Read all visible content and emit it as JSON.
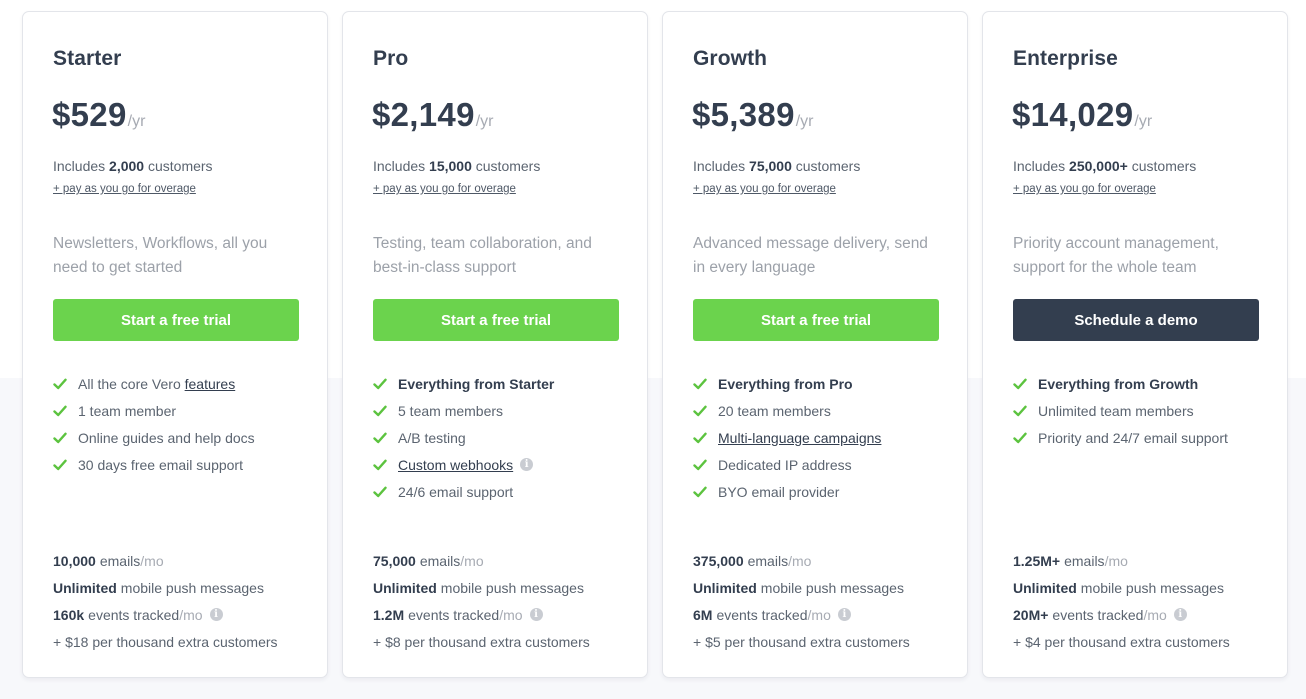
{
  "colors": {
    "accent_green": "#6bd34d",
    "dark_button": "#333e4f",
    "check_green": "#5cc33f"
  },
  "plans": [
    {
      "name": "Starter",
      "price": "$529",
      "period": "/yr",
      "includes_prefix": "Includes",
      "includes_value": "2,000",
      "includes_suffix": "customers",
      "overage_link": "+ pay as you go for overage",
      "description": "Newsletters, Workflows, all you need to get started",
      "cta": "Start a free trial",
      "features": [
        {
          "text": "All the core Vero ",
          "link": "features",
          "bold": false,
          "info": false
        },
        {
          "text": "1 team member",
          "link": "",
          "bold": false,
          "info": false
        },
        {
          "text": "Online guides and help docs",
          "link": "",
          "bold": false,
          "info": false
        },
        {
          "text": "30 days free email support",
          "link": "",
          "bold": false,
          "info": false
        }
      ],
      "limits": {
        "emails_value": "10,000",
        "emails_label": "emails",
        "emails_unit": "/mo",
        "push_value": "Unlimited",
        "push_label": "mobile push messages",
        "events_value": "160k",
        "events_label": "events tracked",
        "events_unit": "/mo",
        "extra": "+ $18 per thousand extra customers"
      }
    },
    {
      "name": "Pro",
      "price": "$2,149",
      "period": "/yr",
      "includes_prefix": "Includes",
      "includes_value": "15,000",
      "includes_suffix": "customers",
      "overage_link": "+ pay as you go for overage",
      "description": "Testing, team collaboration, and best-in-class support",
      "cta": "Start a free trial",
      "features": [
        {
          "text": "Everything from Starter",
          "link": "",
          "bold": true,
          "info": false
        },
        {
          "text": "5 team members",
          "link": "",
          "bold": false,
          "info": false
        },
        {
          "text": "A/B testing",
          "link": "",
          "bold": false,
          "info": false
        },
        {
          "text": "",
          "link": "Custom webhooks",
          "bold": false,
          "info": true
        },
        {
          "text": "24/6 email support",
          "link": "",
          "bold": false,
          "info": false
        }
      ],
      "limits": {
        "emails_value": "75,000",
        "emails_label": "emails",
        "emails_unit": "/mo",
        "push_value": "Unlimited",
        "push_label": "mobile push messages",
        "events_value": "1.2M",
        "events_label": "events tracked",
        "events_unit": "/mo",
        "extra": "+ $8 per thousand extra customers"
      }
    },
    {
      "name": "Growth",
      "price": "$5,389",
      "period": "/yr",
      "includes_prefix": "Includes",
      "includes_value": "75,000",
      "includes_suffix": "customers",
      "overage_link": "+ pay as you go for overage",
      "description": "Advanced message delivery, send in every language",
      "cta": "Start a free trial",
      "features": [
        {
          "text": "Everything from Pro",
          "link": "",
          "bold": true,
          "info": false
        },
        {
          "text": "20 team members",
          "link": "",
          "bold": false,
          "info": false
        },
        {
          "text": "",
          "link": "Multi-language campaigns",
          "bold": false,
          "info": false
        },
        {
          "text": "Dedicated IP address",
          "link": "",
          "bold": false,
          "info": false
        },
        {
          "text": "BYO email provider",
          "link": "",
          "bold": false,
          "info": false
        }
      ],
      "limits": {
        "emails_value": "375,000",
        "emails_label": "emails",
        "emails_unit": "/mo",
        "push_value": "Unlimited",
        "push_label": "mobile push messages",
        "events_value": "6M",
        "events_label": "events tracked",
        "events_unit": "/mo",
        "extra": "+ $5 per thousand extra customers"
      }
    },
    {
      "name": "Enterprise",
      "price": "$14,029",
      "period": "/yr",
      "includes_prefix": "Includes",
      "includes_value": "250,000+",
      "includes_suffix": "customers",
      "overage_link": "+ pay as you go for overage",
      "description": "Priority account management, support for the whole team",
      "cta": "Schedule a demo",
      "features": [
        {
          "text": "Everything from Growth",
          "link": "",
          "bold": true,
          "info": false
        },
        {
          "text": "Unlimited team members",
          "link": "",
          "bold": false,
          "info": false
        },
        {
          "text": "Priority and 24/7 email support",
          "link": "",
          "bold": false,
          "info": false
        }
      ],
      "limits": {
        "emails_value": "1.25M+",
        "emails_label": "emails",
        "emails_unit": "/mo",
        "push_value": "Unlimited",
        "push_label": "mobile push messages",
        "events_value": "20M+",
        "events_label": "events tracked",
        "events_unit": "/mo",
        "extra": "+ $4 per thousand extra customers"
      }
    }
  ]
}
